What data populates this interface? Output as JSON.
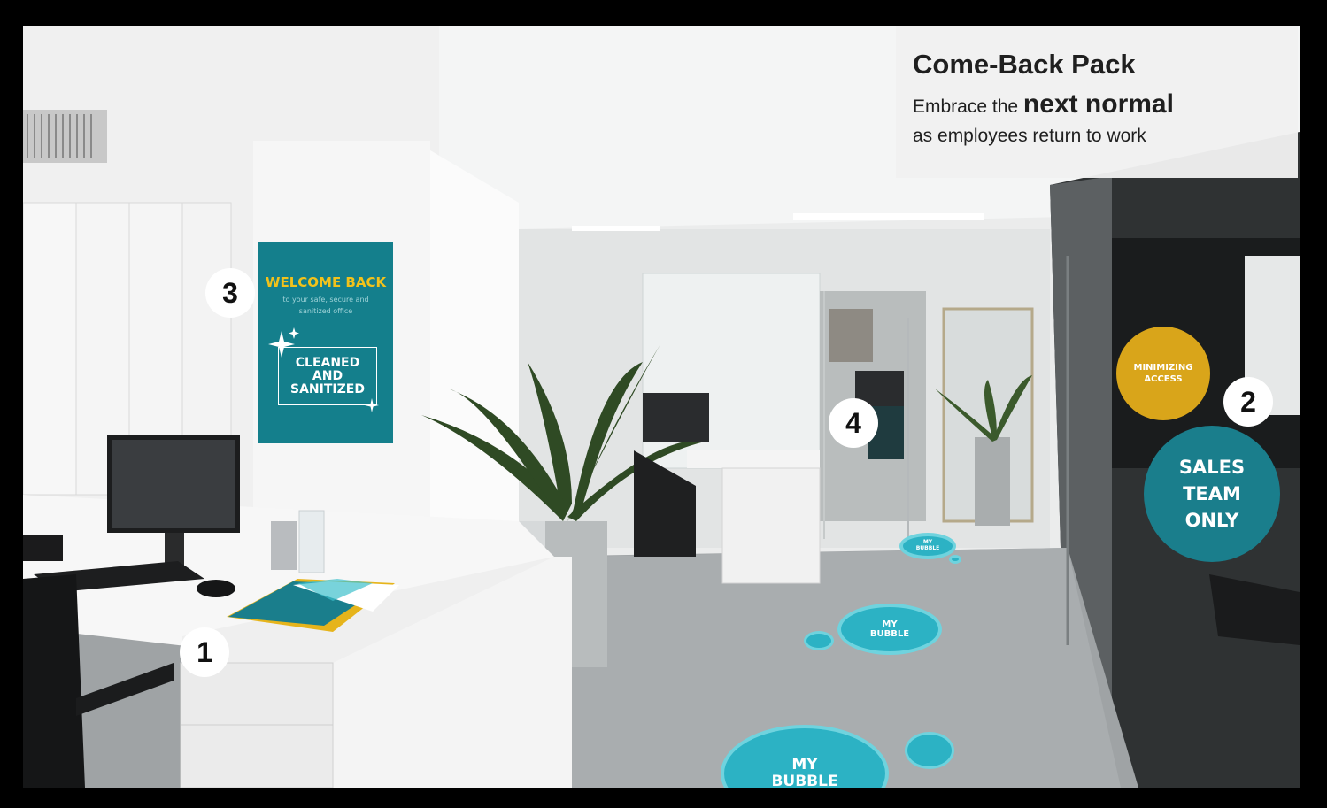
{
  "info": {
    "title": "Come-Back Pack",
    "line1_pre": "Embrace the ",
    "line1_bold": "next normal",
    "line2": "as employees return to work"
  },
  "badges": [
    "1",
    "2",
    "3",
    "4"
  ],
  "poster": {
    "heading": "WELCOME BACK",
    "sub1": "to your safe, secure and",
    "sub2": "sanitized office",
    "line1": "CLEANED",
    "line2": "AND",
    "line3": "SANITIZED"
  },
  "stickers": {
    "yellow_line1": "MINIMIZING",
    "yellow_line2": "ACCESS",
    "teal_line1": "SALES",
    "teal_line2": "TEAM",
    "teal_line3": "ONLY"
  },
  "bubbles": {
    "line1": "MY",
    "line2": "BUBBLE"
  },
  "colors": {
    "teal": "#1a7e8c",
    "yellow": "#d9a51a",
    "bubble": "#2cb2c4"
  }
}
